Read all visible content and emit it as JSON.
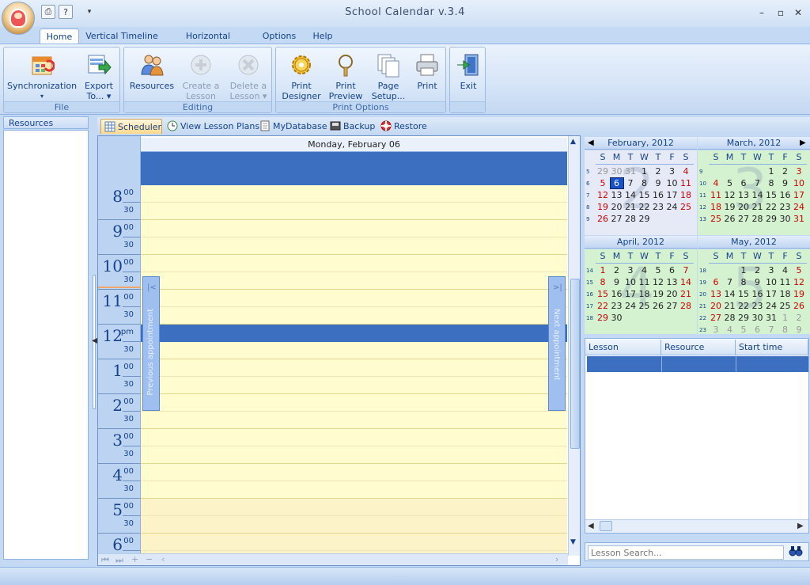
{
  "app": {
    "title": "School Calendar v.3.4"
  },
  "qat": {
    "print_icon": "printer-icon",
    "help_icon": "help-icon",
    "more": "▾"
  },
  "window": {
    "minimize": "–",
    "restore": "▫",
    "close": "✕"
  },
  "tabs": [
    "Home",
    "Vertical Timeline",
    "Horizontal Timeline",
    "Options",
    "Help"
  ],
  "ribbon": {
    "groups": [
      {
        "label": "File",
        "buttons": [
          {
            "l1": "Synchronization",
            "l2": "▾"
          },
          {
            "l1": "Export",
            "l2": "To... ▾"
          }
        ]
      },
      {
        "label": "Editing",
        "buttons": [
          {
            "l1": "Resources",
            "l2": ""
          },
          {
            "l1": "Create a",
            "l2": "Lesson"
          },
          {
            "l1": "Delete a",
            "l2": "Lesson ▾"
          }
        ]
      },
      {
        "label": "Print Options",
        "buttons": [
          {
            "l1": "Print",
            "l2": "Designer"
          },
          {
            "l1": "Print",
            "l2": "Preview"
          },
          {
            "l1": "Page",
            "l2": "Setup..."
          },
          {
            "l1": "Print",
            "l2": ""
          }
        ]
      },
      {
        "label": "",
        "buttons": [
          {
            "l1": "Exit",
            "l2": ""
          }
        ]
      }
    ]
  },
  "left_panel": {
    "title": "Resources"
  },
  "doc_tabs": [
    "Scheduler",
    "View Lesson Plans",
    "MyDatabase",
    "Backup",
    "Restore"
  ],
  "scheduler": {
    "day_header": "Monday, February 06",
    "hours": [
      {
        "h": "8",
        "sup": "00"
      },
      {
        "h": "9",
        "sup": "00"
      },
      {
        "h": "10",
        "sup": "00"
      },
      {
        "h": "11",
        "sup": "00"
      },
      {
        "h": "12",
        "sup": "pm"
      },
      {
        "h": "1",
        "sup": "00"
      },
      {
        "h": "2",
        "sup": "00"
      },
      {
        "h": "3",
        "sup": "00"
      },
      {
        "h": "4",
        "sup": "00"
      },
      {
        "h": "5",
        "sup": "00"
      },
      {
        "h": "6",
        "sup": "00"
      }
    ],
    "half_label": "30",
    "prev_label": "Previous appointment",
    "next_label": "Next appointment",
    "prev_chevron": "|<",
    "next_chevron": ">|"
  },
  "calendars": [
    {
      "title": "February, 2012",
      "watermark": "2",
      "weeks": [
        [
          "5",
          "29",
          "30",
          "31",
          "1",
          "2",
          "3",
          "4"
        ],
        [
          "6",
          "5",
          "6",
          "7",
          "8",
          "9",
          "10",
          "11"
        ],
        [
          "7",
          "12",
          "13",
          "14",
          "15",
          "16",
          "17",
          "18"
        ],
        [
          "8",
          "19",
          "20",
          "21",
          "22",
          "23",
          "24",
          "25"
        ],
        [
          "9",
          "26",
          "27",
          "28",
          "29",
          "",
          "",
          ""
        ]
      ]
    },
    {
      "title": "March, 2012",
      "watermark": "3",
      "weeks": [
        [
          "9",
          "",
          "",
          "",
          "",
          "1",
          "2",
          "3"
        ],
        [
          "10",
          "4",
          "5",
          "6",
          "7",
          "8",
          "9",
          "10"
        ],
        [
          "11",
          "11",
          "12",
          "13",
          "14",
          "15",
          "16",
          "17"
        ],
        [
          "12",
          "18",
          "19",
          "20",
          "21",
          "22",
          "23",
          "24"
        ],
        [
          "13",
          "25",
          "26",
          "27",
          "28",
          "29",
          "30",
          "31"
        ]
      ]
    },
    {
      "title": "April, 2012",
      "watermark": "4",
      "weeks": [
        [
          "14",
          "1",
          "2",
          "3",
          "4",
          "5",
          "6",
          "7"
        ],
        [
          "15",
          "8",
          "9",
          "10",
          "11",
          "12",
          "13",
          "14"
        ],
        [
          "16",
          "15",
          "16",
          "17",
          "18",
          "19",
          "20",
          "21"
        ],
        [
          "17",
          "22",
          "23",
          "24",
          "25",
          "26",
          "27",
          "28"
        ],
        [
          "18",
          "29",
          "30",
          "",
          "",
          "",
          "",
          ""
        ]
      ]
    },
    {
      "title": "May, 2012",
      "watermark": "5",
      "weeks": [
        [
          "18",
          "",
          "",
          "1",
          "2",
          "3",
          "4",
          "5"
        ],
        [
          "19",
          "6",
          "7",
          "8",
          "9",
          "10",
          "11",
          "12"
        ],
        [
          "20",
          "13",
          "14",
          "15",
          "16",
          "17",
          "18",
          "19"
        ],
        [
          "21",
          "20",
          "21",
          "22",
          "23",
          "24",
          "25",
          "26"
        ],
        [
          "22",
          "27",
          "28",
          "29",
          "30",
          "31",
          "1",
          "2"
        ],
        [
          "23",
          "3",
          "4",
          "5",
          "6",
          "7",
          "8",
          "9"
        ]
      ]
    }
  ],
  "dow": [
    "S",
    "M",
    "T",
    "W",
    "T",
    "F",
    "S"
  ],
  "today": "6",
  "lesson_list": {
    "columns": [
      "Lesson",
      "Resource",
      "Start time"
    ]
  },
  "search": {
    "placeholder": "Lesson Search...",
    "icon": "binoculars-icon"
  },
  "colors": {
    "accent": "#3c6fc0",
    "work_hours": "#fffdd0",
    "after_hours": "#fdf3c8",
    "ribbon": "#d5e4f7"
  }
}
